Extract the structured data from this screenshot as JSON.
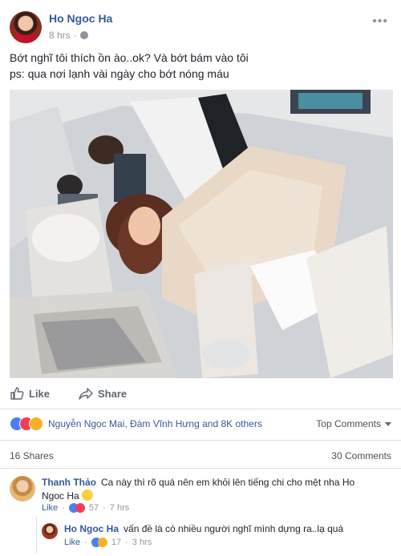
{
  "post": {
    "author": "Ho Ngoc Ha",
    "time": "8 hrs",
    "text_line1": "Bớt nghĩ tôi thích ồn ào..ok? Và bớt bám vào tôi",
    "text_line2": "ps: qua nơi lạnh vài ngày cho bớt nóng máu",
    "more_glyph": "•••"
  },
  "actions": {
    "like": "Like",
    "share": "Share"
  },
  "stats": {
    "reactions_text": "Nguyễn Ngọc Mai, Đàm Vĩnh Hưng and 8K others",
    "top_comments": "Top Comments",
    "shares": "16 Shares",
    "comments": "30 Comments"
  },
  "comments": [
    {
      "name": "Thanh Thảo",
      "text": "Ca này thì rõ quá nên em khỏi lên tiếng chi cho mệt nha Ho Ngoc Ha",
      "like_label": "Like",
      "reaction_count": "57",
      "time": "7 hrs"
    },
    {
      "name": "Ho Ngoc Ha",
      "text": "vấn đề là có nhiều người nghĩ mình dựng ra..lạ quá",
      "like_label": "Like",
      "reaction_count": "17",
      "time": "3 hrs"
    }
  ],
  "colors": {
    "link": "#365899",
    "like_reaction": "#4b7ff2",
    "love_reaction": "#f33e58",
    "haha_reaction": "#f7b125"
  }
}
